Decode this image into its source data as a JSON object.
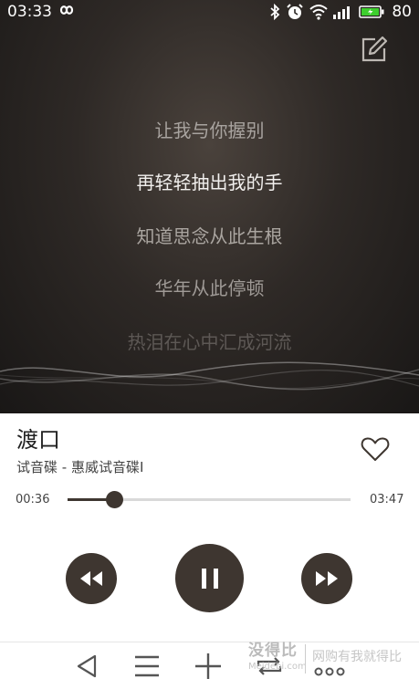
{
  "status": {
    "time": "03:33",
    "battery": "80"
  },
  "lyrics": [
    {
      "text": "让我与你握别",
      "color": "#a8a39f"
    },
    {
      "text": "再轻轻抽出我的手",
      "color": "#f2f0ee"
    },
    {
      "text": "知道思念从此生根",
      "color": "#aaa5a0"
    },
    {
      "text": "华年从此停顿",
      "color": "#9f9a96"
    },
    {
      "text": "热泪在心中汇成河流",
      "color": "#5d5855"
    }
  ],
  "song": {
    "title": "渡口",
    "subtitle": "试音碟 - 惠威试音碟I"
  },
  "progress": {
    "current": "00:36",
    "total": "03:47",
    "fraction": 0.164
  },
  "icons": {
    "edit": "edit-icon",
    "favorite": "heart-outline-icon",
    "prev": "rewind-icon",
    "play": "pause-icon",
    "next": "fast-forward-icon",
    "nav": [
      "back-icon",
      "menu-icon",
      "plus-icon",
      "repeat-icon",
      "more-icon"
    ]
  },
  "colors": {
    "accent": "#3e3630",
    "hero_bg": "#2e2926"
  },
  "watermark": {
    "main": "没得比",
    "sub": "Meidebi.com",
    "tag": "网购有我就得比"
  }
}
